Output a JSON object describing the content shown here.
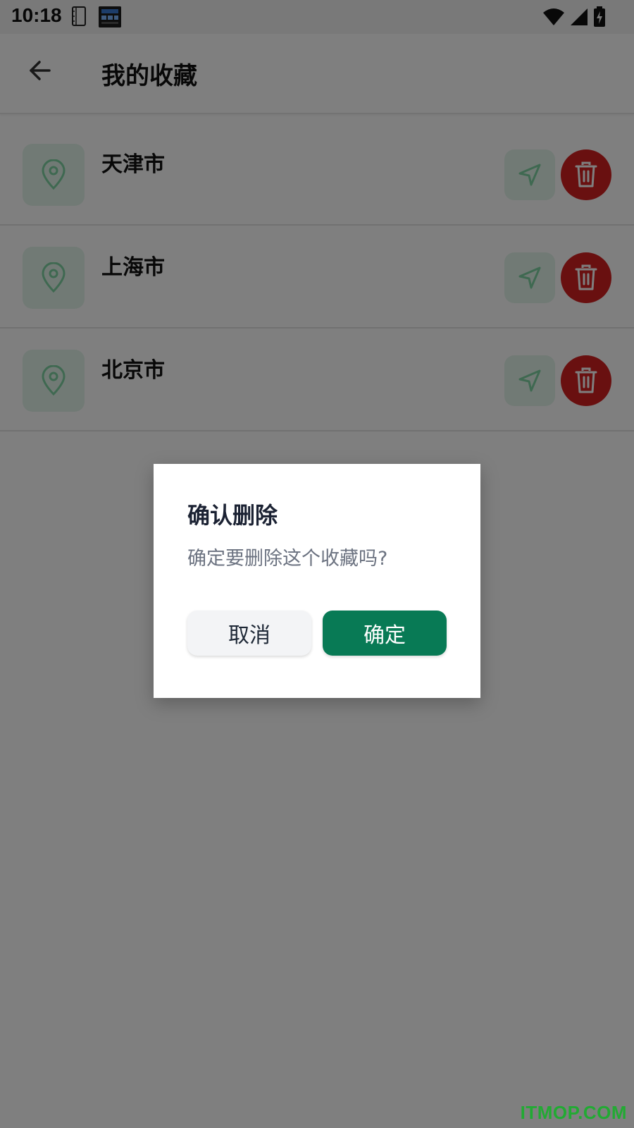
{
  "status_bar": {
    "time": "10:18",
    "icons": [
      "phone-icon",
      "app-notification-icon",
      "wifi-icon",
      "cell-signal-icon",
      "battery-charging-icon"
    ]
  },
  "app_bar": {
    "title": "我的收藏",
    "back_icon": "arrow-left-icon"
  },
  "favorites": [
    {
      "name": "天津市"
    },
    {
      "name": "上海市"
    },
    {
      "name": "北京市"
    }
  ],
  "icons": {
    "location": "map-pin-icon",
    "navigate": "navigation-arrow-icon",
    "delete": "trash-icon"
  },
  "dialog": {
    "title": "确认删除",
    "message": "确定要删除这个收藏吗?",
    "cancel_label": "取消",
    "confirm_label": "确定"
  },
  "colors": {
    "accent_green": "#087a55",
    "light_green": "#e2f5ea",
    "danger_red": "#d22020",
    "scrim": "rgba(0,0,0,0.5)"
  },
  "watermark": "ITMOP.COM"
}
